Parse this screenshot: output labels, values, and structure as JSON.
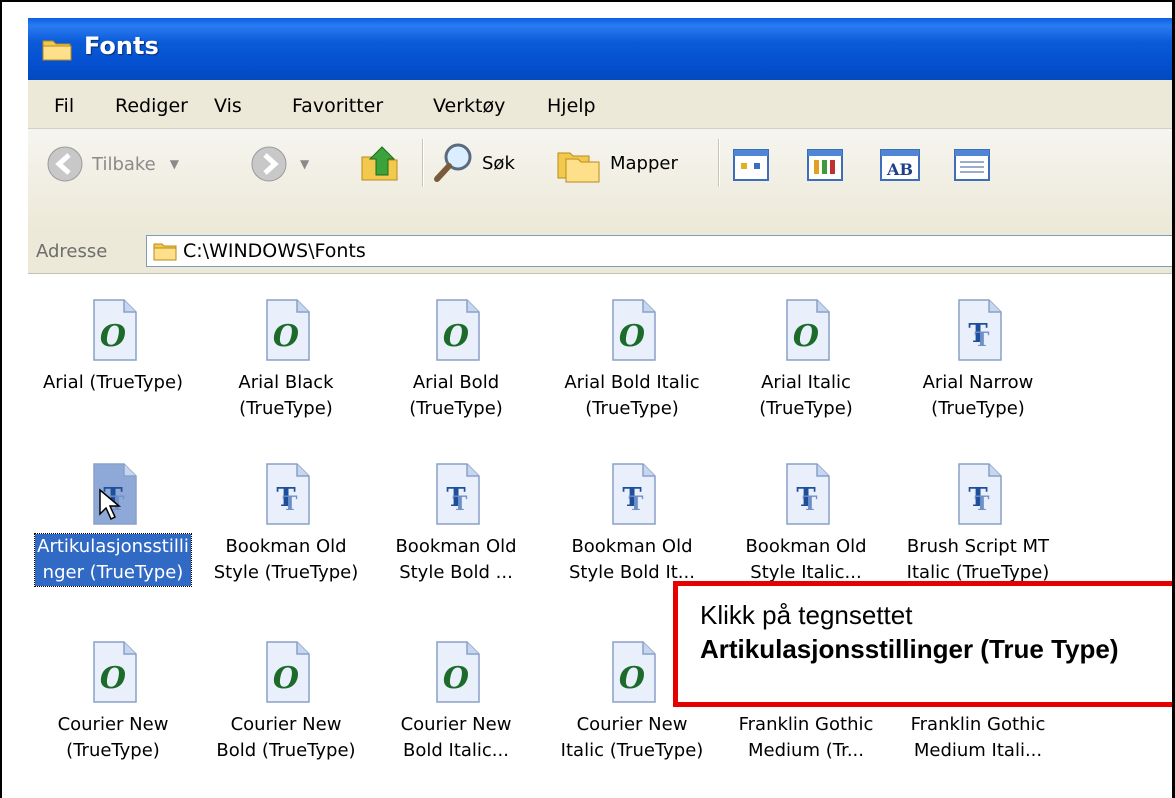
{
  "window": {
    "title": "Fonts",
    "icon": "folder-icon"
  },
  "menu": {
    "items": [
      "Fil",
      "Rediger",
      "Vis",
      "Favoritter",
      "Verktøy",
      "Hjelp"
    ]
  },
  "toolbar": {
    "back_label": "Tilbake",
    "search_label": "Søk",
    "folders_label": "Mapper",
    "view_buttons": [
      "view-thumbnails-icon",
      "view-tiles-icon",
      "view-ab-icon",
      "view-details-icon"
    ]
  },
  "address": {
    "label": "Adresse",
    "value": "C:\\WINDOWS\\Fonts"
  },
  "fonts": [
    {
      "label": "Arial (TrueType)",
      "icon": "opentype-font-icon"
    },
    {
      "label": "Arial Black\n(TrueType)",
      "icon": "opentype-font-icon"
    },
    {
      "label": "Arial Bold\n(TrueType)",
      "icon": "opentype-font-icon"
    },
    {
      "label": "Arial Bold Italic\n(TrueType)",
      "icon": "opentype-font-icon"
    },
    {
      "label": "Arial Italic\n(TrueType)",
      "icon": "opentype-font-icon"
    },
    {
      "label": "Arial Narrow\n(TrueType)",
      "icon": "truetype-font-icon"
    },
    {
      "label": "Artikulasjonsstilli\nnger (TrueType)",
      "icon": "truetype-font-icon",
      "selected": true
    },
    {
      "label": "Bookman Old\nStyle (TrueType)",
      "icon": "truetype-font-icon"
    },
    {
      "label": "Bookman Old\nStyle Bold ...",
      "icon": "truetype-font-icon"
    },
    {
      "label": "Bookman Old\nStyle Bold It...",
      "icon": "truetype-font-icon"
    },
    {
      "label": "Bookman Old\nStyle Italic...",
      "icon": "truetype-font-icon"
    },
    {
      "label": "Brush Script MT\nItalic (TrueType)",
      "icon": "truetype-font-icon"
    },
    {
      "label": "Courier New\n(TrueType)",
      "icon": "opentype-font-icon"
    },
    {
      "label": "Courier New\nBold (TrueType)",
      "icon": "opentype-font-icon"
    },
    {
      "label": "Courier New\nBold Italic...",
      "icon": "opentype-font-icon"
    },
    {
      "label": "Courier New\nItalic (TrueType)",
      "icon": "opentype-font-icon"
    },
    {
      "label": "Franklin Gothic\nMedium (Tr...",
      "icon": "opentype-font-icon"
    },
    {
      "label": "Franklin Gothic\nMedium Itali...",
      "icon": "opentype-font-icon"
    }
  ],
  "callout": {
    "line1": "Klikk på tegnsettet",
    "line2": "Artikulasjonsstillinger (True Type)",
    "border_color": "#e60000"
  },
  "colors": {
    "titlebar": "#0a5ad8",
    "selection": "#316ac5",
    "chrome": "#ece9d8"
  }
}
